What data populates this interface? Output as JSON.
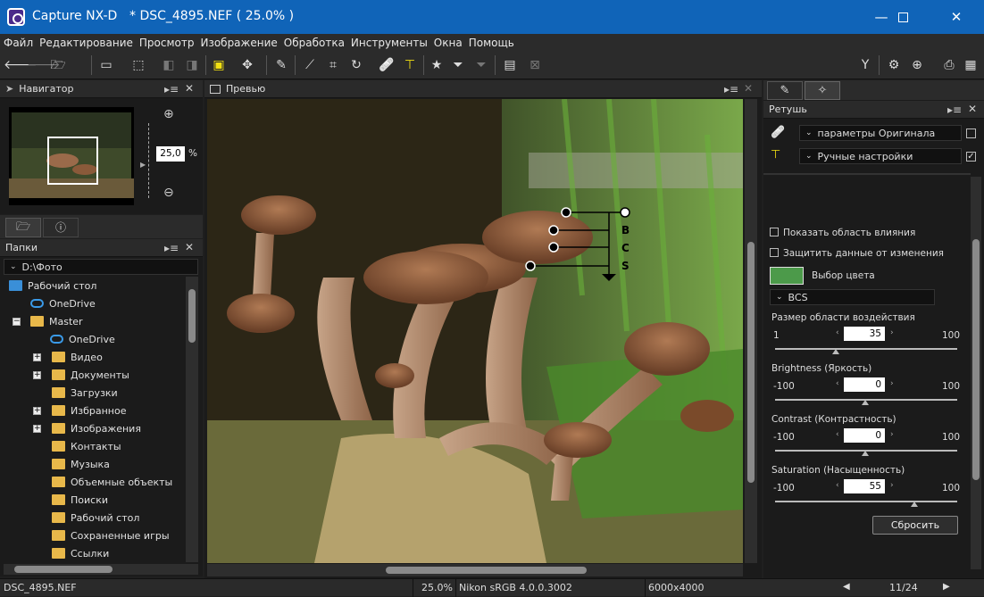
{
  "window": {
    "app_title": "Capture NX-D",
    "doc_title": "* DSC_4895.NEF ( 25.0% )"
  },
  "menu": [
    "Файл",
    "Редактирование",
    "Просмотр",
    "Изображение",
    "Обработка",
    "Инструменты",
    "Окна",
    "Помощь"
  ],
  "navigator": {
    "title": "Навигатор",
    "zoom_value": "25,0",
    "zoom_unit": "%"
  },
  "folders": {
    "title": "Папки",
    "path": "D:\\Фото",
    "items": [
      "Рабочий стол",
      "OneDrive",
      "Master",
      "OneDrive",
      "Видео",
      "Документы",
      "Загрузки",
      "Избранное",
      "Изображения",
      "Контакты",
      "Музыка",
      "Объемные объекты",
      "Поиски",
      "Рабочий стол",
      "Сохраненные игры",
      "Ссылки"
    ]
  },
  "preview": {
    "title": "Превью",
    "labels": {
      "b": "B",
      "c": "C",
      "s": "S"
    }
  },
  "retouch": {
    "title": "Ретушь",
    "row1": "параметры Оригинала",
    "row2": "Ручные настройки",
    "show_area": "Показать область влияния",
    "protect": "Защитить данные от изменения",
    "color_pick": "Выбор цвета",
    "mode": "BCS",
    "size": {
      "label": "Размер области воздействия",
      "min": "1",
      "max": "100",
      "value": "35"
    },
    "brightness": {
      "label": "Brightness (Яркость)",
      "min": "-100",
      "max": "100",
      "value": "0"
    },
    "contrast": {
      "label": "Contrast (Контрастность)",
      "min": "-100",
      "max": "100",
      "value": "0"
    },
    "saturation": {
      "label": "Saturation (Насыщенность)",
      "min": "-100",
      "max": "100",
      "value": "55"
    },
    "reset": "Сбросить"
  },
  "status": {
    "file": "DSC_4895.NEF",
    "zoom": "25.0%",
    "profile": "Nikon sRGB 4.0.0.3002",
    "dims": "6000x4000",
    "counter": "11/24"
  },
  "colors": {
    "accent": "#1064b8",
    "pick_color": "#4c9a4a"
  }
}
